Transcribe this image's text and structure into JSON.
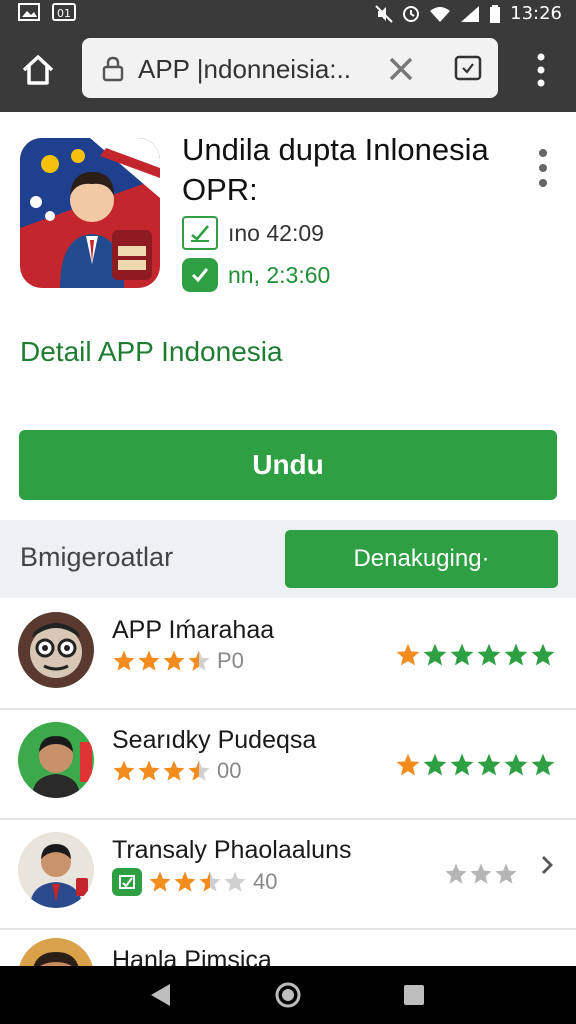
{
  "status_bar": {
    "time": "13:26",
    "left_icons": [
      "image-icon",
      "nfc-icon"
    ],
    "right_icons": [
      "mute-icon",
      "alarm-icon",
      "wifi-icon",
      "signal-icon",
      "battery-icon"
    ]
  },
  "browser": {
    "url": "APP |ndonneisia:..",
    "icons": [
      "home-icon",
      "lock-icon",
      "close-icon",
      "tab-icon",
      "overflow-menu-icon"
    ]
  },
  "app": {
    "title": "Undila dupta Inlonesia OPR:",
    "meta_1": "ıno 42:09",
    "meta_2": "nn, 2:3:60",
    "detail_link": "Detail APP Indonesia",
    "install_label": "Undu"
  },
  "section": {
    "label": "Bmigeroatlar",
    "button_label": "Denakuging·"
  },
  "list": [
    {
      "name": "APP Iḿarahaa",
      "rating_text": "P0",
      "small_stars": 3.5,
      "big_stars": 6,
      "avatar": "caricature-glasses-avatar"
    },
    {
      "name": "Searıdky Pudeqsa",
      "rating_text": "00",
      "small_stars": 3.5,
      "big_stars": 6,
      "avatar": "man-portrait-avatar"
    },
    {
      "name": "Transaly Phaolaaluns",
      "rating_text": "40",
      "small_stars": 2.5,
      "big_stars": 3,
      "avatar": "man-suit-avatar"
    },
    {
      "name": "Hanla Pimsica",
      "rating_text": "",
      "small_stars": 0,
      "big_stars": 0,
      "avatar": "man-glasses-avatar"
    }
  ],
  "colors": {
    "accent": "#2ea043",
    "star_orange": "#f28c1e",
    "star_green": "#2ea043",
    "star_grey": "#b5b5b5",
    "toolbar": "#3a3a3a"
  }
}
